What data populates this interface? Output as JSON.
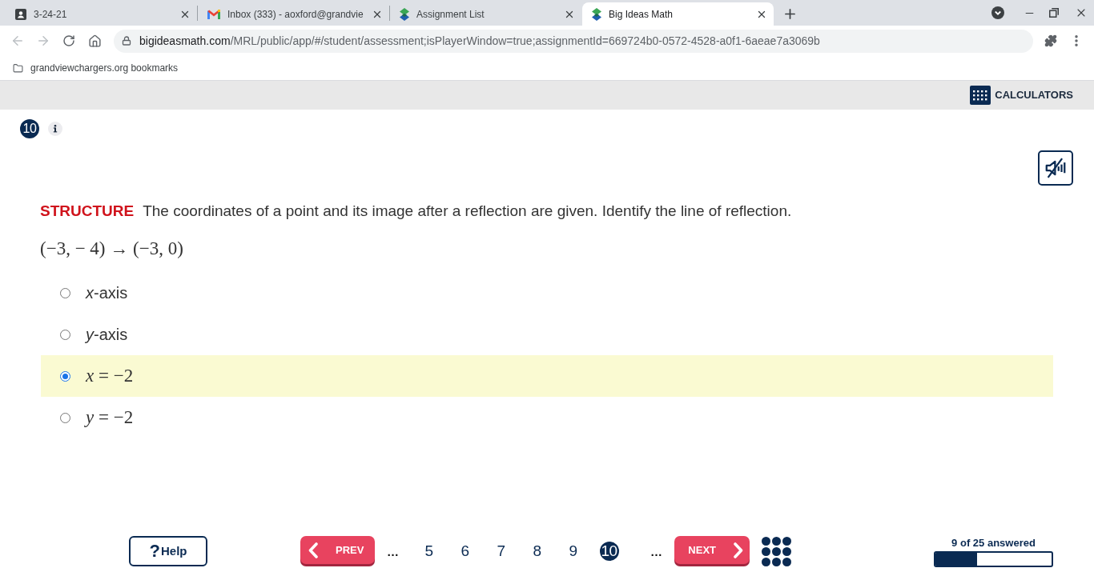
{
  "browser": {
    "tabs": [
      {
        "title": "3-24-21",
        "kind": "contact",
        "selected": false
      },
      {
        "title": "Inbox (333) - aoxford@grandvie",
        "kind": "mail",
        "selected": false
      },
      {
        "title": "Assignment List",
        "kind": "logo",
        "selected": false
      },
      {
        "title": "Big Ideas Math",
        "kind": "logo",
        "selected": true
      }
    ],
    "url": {
      "host": "bigideasmath.com",
      "path": "/MRL/public/app/#/student/assessment;isPlayerWindow=true;assignmentId=669724b0-0572-4528-a0f1-6aeae7a3069b"
    },
    "bookmarks": [
      {
        "label": "grandviewchargers.org bookmarks"
      }
    ]
  },
  "toolbar": {
    "calculators": "CALCULATORS"
  },
  "question": {
    "number": "10",
    "label": "STRUCTURE",
    "prompt": "The coordinates of a point and its image after a reflection are given. Identify the line of reflection.",
    "expression": "(−3, − 4) → (−3, 0)",
    "options": [
      {
        "kind": "text",
        "label": "*x*-axis",
        "selected": false
      },
      {
        "kind": "text",
        "label": "*y*-axis",
        "selected": false
      },
      {
        "kind": "math",
        "label": "*x* = −2",
        "selected": true
      },
      {
        "kind": "math",
        "label": "*y* = −2",
        "selected": false
      }
    ]
  },
  "footer": {
    "help": {
      "glyph": "?",
      "label": "Help"
    },
    "prev": "PREV",
    "pages": [
      {
        "kind": "ellipsis",
        "label": "…",
        "selected": false
      },
      {
        "kind": "page",
        "label": "5",
        "selected": false
      },
      {
        "kind": "page",
        "label": "6",
        "selected": false
      },
      {
        "kind": "page",
        "label": "7",
        "selected": false
      },
      {
        "kind": "page",
        "label": "8",
        "selected": false
      },
      {
        "kind": "page",
        "label": "9",
        "selected": false
      },
      {
        "kind": "page",
        "label": "10",
        "selected": true
      },
      {
        "kind": "ellipsis",
        "label": "…",
        "selected": false
      }
    ],
    "next": "NEXT",
    "progress": {
      "text": "9 of 25 answered",
      "level": 0.36
    }
  }
}
